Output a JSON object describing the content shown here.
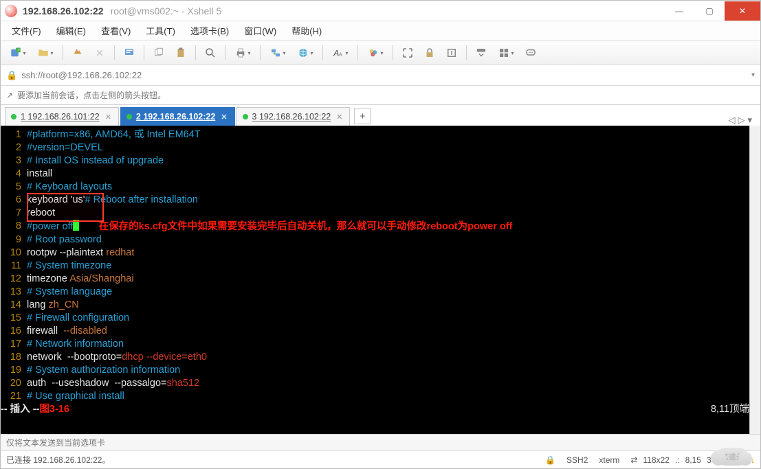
{
  "title": {
    "main": "192.168.26.102:22",
    "sub": "root@vms002:~ - Xshell 5"
  },
  "win_controls": {
    "min": "—",
    "max": "▢",
    "close": "✕"
  },
  "menu": [
    "文件(F)",
    "编辑(E)",
    "查看(V)",
    "工具(T)",
    "选项卡(B)",
    "窗口(W)",
    "帮助(H)"
  ],
  "addr": {
    "lock": "🔒",
    "url": "ssh://root@192.168.26.102:22",
    "dd": "▾"
  },
  "hint": {
    "icon": "↗",
    "text": "要添加当前会话，点击左侧的箭头按钮。"
  },
  "tabs": [
    {
      "label": "1 192.168.26.101:22",
      "active": false
    },
    {
      "label": "2 192.168.26.102:22",
      "active": true
    },
    {
      "label": "3 192.168.26.102:22",
      "active": false
    }
  ],
  "tab_add": "+",
  "tab_nav": {
    "left": "◁",
    "right": "▷",
    "dd": "▾"
  },
  "annotation": "在保存的ks.cfg文件中如果需要安装完毕后自动关机，那么就可以手动修改reboot为power off",
  "lines": [
    {
      "n": "1",
      "cls": "c-comment",
      "t": "#platform=x86, AMD64, 或 Intel EM64T"
    },
    {
      "n": "2",
      "cls": "c-comment",
      "t": "#version=DEVEL"
    },
    {
      "n": "3",
      "cls": "c-comment",
      "t": "# Install OS instead of upgrade"
    },
    {
      "n": "4",
      "cls": "c-cmd",
      "t": "install"
    },
    {
      "n": "5",
      "cls": "c-comment",
      "t": "# Keyboard layouts"
    },
    {
      "n": "6",
      "cls": "",
      "t": ""
    },
    {
      "n": "7",
      "cls": "c-cmd",
      "t": "reboot"
    },
    {
      "n": "8",
      "cls": "",
      "t": ""
    },
    {
      "n": "9",
      "cls": "c-comment",
      "t": "# Root password"
    },
    {
      "n": "10",
      "cls": "",
      "t": ""
    },
    {
      "n": "11",
      "cls": "c-comment",
      "t": "# System timezone"
    },
    {
      "n": "12",
      "cls": "",
      "t": ""
    },
    {
      "n": "13",
      "cls": "c-comment",
      "t": "# System language"
    },
    {
      "n": "14",
      "cls": "",
      "t": ""
    },
    {
      "n": "15",
      "cls": "c-comment",
      "t": "# Firewall configuration"
    },
    {
      "n": "16",
      "cls": "",
      "t": ""
    },
    {
      "n": "17",
      "cls": "c-comment",
      "t": "# Network information"
    },
    {
      "n": "18",
      "cls": "",
      "t": ""
    },
    {
      "n": "19",
      "cls": "c-comment",
      "t": "# System authorization information"
    },
    {
      "n": "20",
      "cls": "",
      "t": ""
    },
    {
      "n": "21",
      "cls": "c-comment",
      "t": "# Use graphical install"
    }
  ],
  "line6": {
    "a": "keyboard 'us'",
    "b": "# Reboot after installation"
  },
  "line8": "#power off",
  "line10": {
    "a": "rootpw --plaintext ",
    "b": "redhat"
  },
  "line12": {
    "a": "timezone ",
    "b": "Asia/Shanghai"
  },
  "line14": {
    "a": "lang ",
    "b": "zh_CN"
  },
  "line16": {
    "a": "firewall ",
    "b": " --disabled"
  },
  "line18": {
    "a": "network  --bootproto=",
    "b": "dhcp --device=eth0"
  },
  "line20": {
    "a": "auth  --useshadow  --passalgo=",
    "b": "sha512"
  },
  "status": {
    "mode": "-- 插入 --",
    "fig": "图3-16",
    "pos": "8,11",
    "top": "顶端"
  },
  "footer_input": "仅将文本发送到当前选项卡",
  "statusbar": {
    "conn": "已连接 192.168.26.102:22。",
    "ssh": "SSH2",
    "term": "xterm",
    "size": "118x22",
    "cursor": "8,15",
    "sess": "3 会话"
  },
  "status_icons": {
    "lock": "🔒",
    "rc": "⇄",
    "dot": ".:",
    "up": "↑",
    "down": "↓"
  },
  "watermark": "亿速云"
}
